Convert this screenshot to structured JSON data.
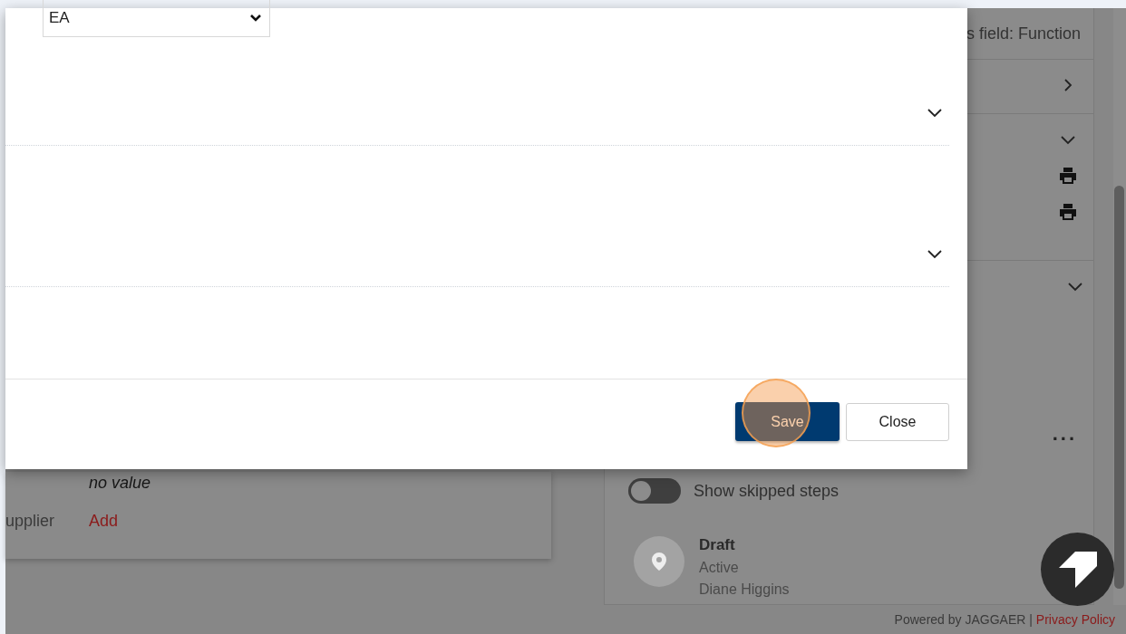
{
  "modal": {
    "unit_select": {
      "value": "EA"
    },
    "sections": [
      {
        "expanded": false
      },
      {
        "expanded": false
      }
    ],
    "buttons": [
      {
        "label": "Save",
        "kind": "primary"
      },
      {
        "label": "Close",
        "kind": "secondary"
      }
    ]
  },
  "details_card": {
    "fields": [
      {
        "value": "no value",
        "kind": "empty"
      },
      {
        "label": "upplier",
        "value": "Add",
        "kind": "link"
      }
    ]
  },
  "right_panel": {
    "header": "s field: Function",
    "rows": [
      {
        "expanded": false
      },
      {
        "expanded": true
      },
      {
        "expanded": true
      }
    ],
    "more": "...",
    "skipped_toggle": {
      "label": "Show skipped steps",
      "on": false
    },
    "steps": [
      {
        "title": "Draft",
        "status": "Active",
        "person": "Diane Higgins"
      }
    ]
  },
  "footer": {
    "powered_by": "Powered by JAGGAER |",
    "link": "Privacy Policy"
  }
}
